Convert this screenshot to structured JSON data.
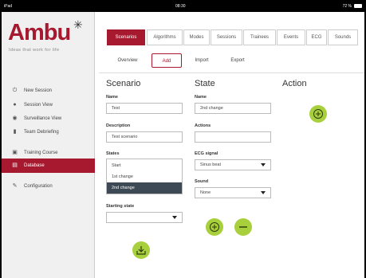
{
  "statusbar": {
    "left": "iPad",
    "time": "08:30",
    "right": "72 %"
  },
  "brand": {
    "name": "Ambu",
    "tagline": "Ideas that work for life"
  },
  "sidebar": {
    "items": [
      {
        "label": "New Session",
        "icon": "power-icon"
      },
      {
        "label": "Session View",
        "icon": "person-icon"
      },
      {
        "label": "Surveillance View",
        "icon": "eye-icon"
      },
      {
        "label": "Team Debriefing",
        "icon": "document-icon"
      },
      {
        "label": "Training Course",
        "icon": "monitor-icon"
      },
      {
        "label": "Database",
        "icon": "database-icon",
        "active": true
      },
      {
        "label": "Configuration",
        "icon": "wrench-icon"
      }
    ]
  },
  "tabs": [
    "Scenarios",
    "Algorithms",
    "Modes",
    "Sessions",
    "Trainees",
    "Events",
    "ECG",
    "Sounds"
  ],
  "active_tab": "Scenarios",
  "subtabs": [
    "Overview",
    "Add",
    "Import",
    "Export"
  ],
  "active_subtab": "Add",
  "scenario": {
    "heading": "Scenario",
    "name_label": "Name",
    "name_value": "Test",
    "description_label": "Description",
    "description_value": "Test scenario",
    "states_label": "States",
    "states": [
      "Start",
      "1st change",
      "2nd change"
    ],
    "selected_state": "2nd change",
    "starting_state_label": "Starting state",
    "starting_state_value": ""
  },
  "state": {
    "heading": "State",
    "name_label": "Name",
    "name_value": "2nd change",
    "actions_label": "Actions",
    "actions_value": "",
    "ecg_label": "ECG signal",
    "ecg_value": "Sinus beat",
    "sound_label": "Sound",
    "sound_value": "None"
  },
  "action": {
    "heading": "Action"
  },
  "colors": {
    "brand": "#a6192e",
    "button_green": "#a8cf3c",
    "selected_row": "#3d4a55"
  }
}
